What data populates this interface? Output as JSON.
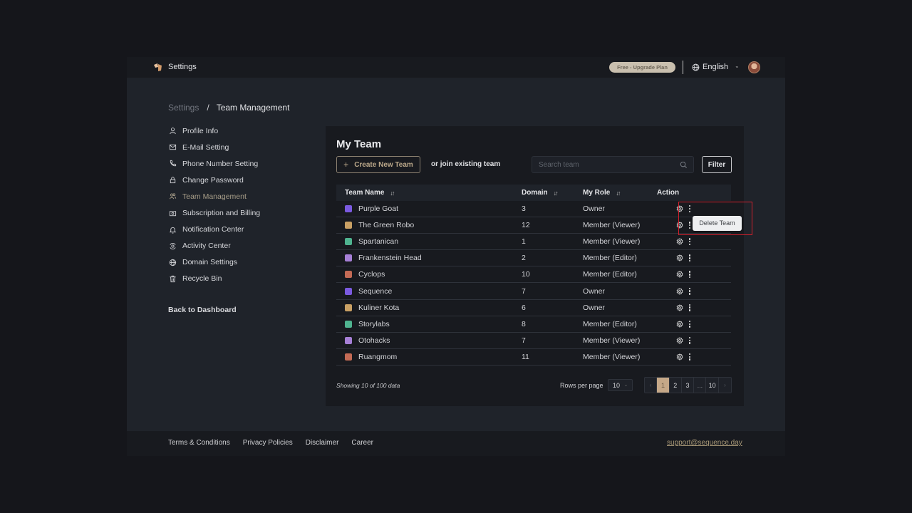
{
  "topbar": {
    "title": "Settings",
    "upgrade_label": "Free - Upgrade Plan",
    "language": "English"
  },
  "breadcrumb": {
    "root": "Settings",
    "separator": "/",
    "current": "Team Management"
  },
  "sidebar": {
    "items": [
      {
        "label": "Profile Info",
        "icon": "user-icon",
        "active": false
      },
      {
        "label": "E-Mail Setting",
        "icon": "mail-icon",
        "active": false
      },
      {
        "label": "Phone Number Setting",
        "icon": "phone-icon",
        "active": false
      },
      {
        "label": "Change Password",
        "icon": "lock-icon",
        "active": false
      },
      {
        "label": "Team Management",
        "icon": "team-icon",
        "active": true
      },
      {
        "label": "Subscription and Billing",
        "icon": "billing-icon",
        "active": false
      },
      {
        "label": "Notification Center",
        "icon": "bell-icon",
        "active": false
      },
      {
        "label": "Activity Center",
        "icon": "activity-icon",
        "active": false
      },
      {
        "label": "Domain Settings",
        "icon": "globe-icon",
        "active": false
      },
      {
        "label": "Recycle Bin",
        "icon": "trash-icon",
        "active": false
      }
    ],
    "back_label": "Back to Dashboard"
  },
  "card": {
    "title": "My Team",
    "create_label": "Create New Team",
    "join_text": "or join existing team",
    "search_placeholder": "Search team",
    "filter_label": "Filter"
  },
  "table": {
    "headers": {
      "name": "Team Name",
      "domain": "Domain",
      "role": "My Role",
      "action": "Action"
    },
    "rows": [
      {
        "name": "Purple Goat",
        "domain": "3",
        "role": "Owner",
        "icon_color": "#7b5ae0"
      },
      {
        "name": "The Green Robo",
        "domain": "12",
        "role": "Member (Viewer)",
        "icon_color": "#c9a064"
      },
      {
        "name": "Spartanican",
        "domain": "1",
        "role": "Member (Viewer)",
        "icon_color": "#4fb38f"
      },
      {
        "name": "Frankenstein Head",
        "domain": "2",
        "role": "Member (Editor)",
        "icon_color": "#a67fd6"
      },
      {
        "name": "Cyclops",
        "domain": "10",
        "role": "Member (Editor)",
        "icon_color": "#c36a55"
      },
      {
        "name": "Sequence",
        "domain": "7",
        "role": "Owner",
        "icon_color": "#7b5ae0"
      },
      {
        "name": "Kuliner Kota",
        "domain": "6",
        "role": "Owner",
        "icon_color": "#c9a064"
      },
      {
        "name": "Storylabs",
        "domain": "8",
        "role": "Member (Editor)",
        "icon_color": "#4fb38f"
      },
      {
        "name": "Otohacks",
        "domain": "7",
        "role": "Member (Viewer)",
        "icon_color": "#a67fd6"
      },
      {
        "name": "Ruangmom",
        "domain": "11",
        "role": "Member (Viewer)",
        "icon_color": "#c36a55"
      }
    ]
  },
  "tooltip": {
    "label": "Delete Team"
  },
  "pagination": {
    "showing_text": "Showing 10 of 100 data",
    "rows_label": "Rows per page",
    "rows_value": "10",
    "pages": [
      "1",
      "2",
      "3",
      "...",
      "10"
    ],
    "current_page": "1",
    "prev": "‹",
    "next": "›"
  },
  "footer": {
    "links": [
      "Terms & Conditions",
      "Privacy Policies",
      "Disclaimer",
      "Career"
    ],
    "support_email": "support@sequence.day"
  }
}
